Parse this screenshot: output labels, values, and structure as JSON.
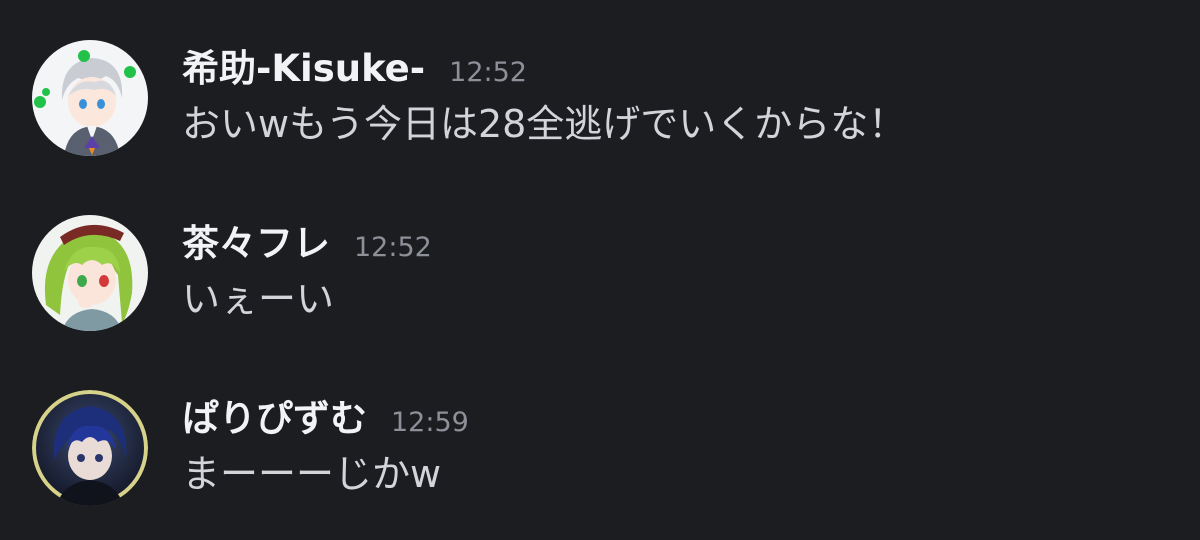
{
  "messages": [
    {
      "author": "希助-Kisuke-",
      "time": "12:52",
      "text": "おいwもう今日は28全逃げでいくからな！",
      "avatar_icon": "anime-boy-silver-hair-avatar"
    },
    {
      "author": "茶々フレ",
      "time": "12:52",
      "text": "いぇーい",
      "avatar_icon": "anime-girl-green-hair-avatar"
    },
    {
      "author": "ぱりぴずむ",
      "time": "12:59",
      "text": "まーーーじかw",
      "avatar_icon": "anime-boy-dark-hair-avatar"
    }
  ],
  "colors": {
    "background": "#1c1d21",
    "username": "#f2f3f5",
    "timestamp": "#8e9099",
    "message_text": "#d2d4d9"
  }
}
